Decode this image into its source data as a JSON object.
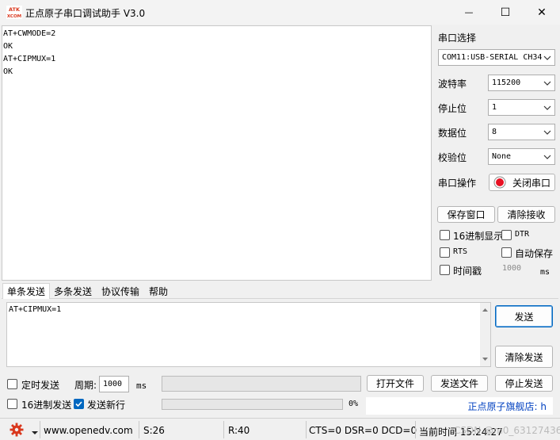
{
  "window": {
    "logo_text_top": "ATK",
    "logo_text_bottom": "XCOM",
    "title": "正点原子串口调试助手 V3.0",
    "minimize_glyph": "—",
    "maximize_glyph": "☐",
    "close_glyph": "✕"
  },
  "receive": {
    "lines": [
      "AT+CWMODE=2",
      "OK",
      "AT+CIPMUX=1",
      "OK"
    ]
  },
  "settings": {
    "port_label": "串口选择",
    "port_value": "COM11:USB-SERIAL CH34",
    "baud_label": "波特率",
    "baud_value": "115200",
    "stop_label": "停止位",
    "stop_value": "1",
    "data_label": "数据位",
    "data_value": "8",
    "parity_label": "校验位",
    "parity_value": "None",
    "op_label": "串口操作",
    "close_port_label": "关闭串口"
  },
  "actions": {
    "save_window": "保存窗口",
    "clear_receive": "清除接收"
  },
  "options": {
    "hex_display": "16进制显示",
    "dtr": "DTR",
    "rts": "RTS",
    "auto_save": "自动保存",
    "timestamp": "时间戳",
    "timestamp_value": "1000",
    "timestamp_unit": "ms"
  },
  "tabs": [
    "单条发送",
    "多条发送",
    "协议传输",
    "帮助"
  ],
  "send": {
    "text": "AT+CIPMUX=1",
    "send_label": "发送",
    "clear_send_label": "清除发送"
  },
  "bottom": {
    "timed_send": "定时发送",
    "period_label": "周期:",
    "period_value": "1000",
    "period_unit": "ms",
    "open_file": "打开文件",
    "send_file": "发送文件",
    "stop_send": "停止发送",
    "hex_send": "16进制发送",
    "send_newline": "发送新行",
    "percent": "0%",
    "store_text": "正点原子旗舰店: h"
  },
  "status": {
    "url": "www.openedv.com",
    "sent": "S:26",
    "received": "R:40",
    "signals": "CTS=0 DSR=0 DCD=0",
    "time": "当前时间 15:24:27"
  },
  "watermark": "CSDN @m0_63127436",
  "colors": {
    "accent": "#0067c0",
    "record_red": "#e81123",
    "gear_red": "#d9381e",
    "link_blue": "#0040c0"
  }
}
